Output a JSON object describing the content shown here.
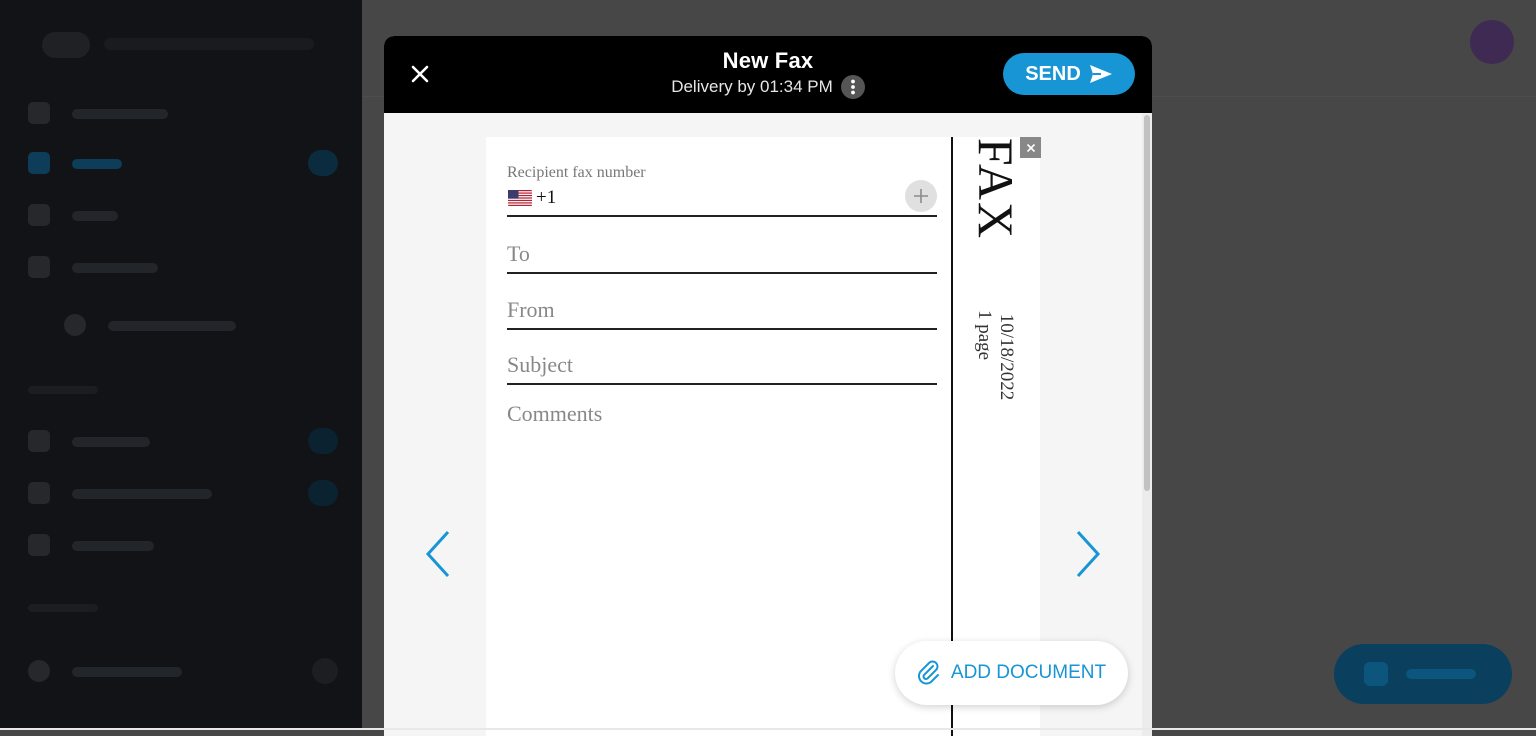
{
  "modal": {
    "title": "New Fax",
    "delivery": "Delivery by 01:34 PM",
    "send_label": "SEND"
  },
  "fax_form": {
    "recipient_label": "Recipient fax number",
    "country_code": "+1",
    "to_placeholder": "To",
    "from_placeholder": "From",
    "subject_placeholder": "Subject",
    "comments_placeholder": "Comments"
  },
  "cover": {
    "heading": "FAX",
    "date": "10/18/2022",
    "pages": "1 page"
  },
  "add_document_label": "ADD DOCUMENT",
  "icons": {
    "close": "close-icon",
    "info": "more-vertical-icon",
    "send": "send-arrow-icon",
    "flag": "us-flag-icon",
    "add": "plus-icon",
    "remove": "close-icon",
    "prev": "chevron-left-icon",
    "next": "chevron-right-icon",
    "attach": "paperclip-icon"
  },
  "colors": {
    "accent": "#1795d4",
    "header_bg": "#000000",
    "overlay": "#474747"
  }
}
